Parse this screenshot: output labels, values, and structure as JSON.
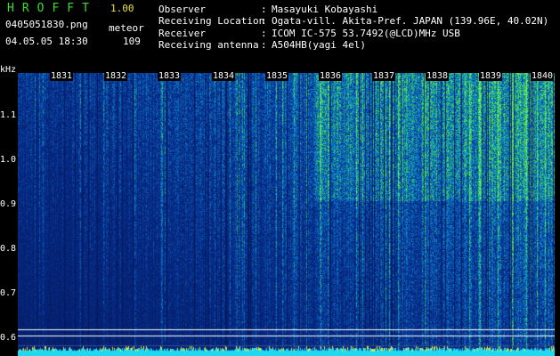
{
  "header": {
    "brand": "HROFFT",
    "version": "1.00",
    "filename": "0405051830.png",
    "mode": "meteor",
    "datetime": "04.05.05 18:30",
    "count": "109"
  },
  "station": [
    {
      "label": "Observer",
      "sep": ":",
      "value": "Masayuki Kobayashi"
    },
    {
      "label": "Receiving Location",
      "sep": ":",
      "value": "Ogata-vill. Akita-Pref. JAPAN (139.96E, 40.02N)"
    },
    {
      "label": "Receiver",
      "sep": ":",
      "value": "ICOM IC-575 53.7492(@LCD)MHz USB"
    },
    {
      "label": "Receiving antenna",
      "sep": ":",
      "value": "A504HB(yagi 4el)"
    }
  ],
  "axis": {
    "unit": "kHz",
    "y_ticks": [
      "1.1",
      "1.0",
      "0.9",
      "0.8",
      "0.7",
      "0.6"
    ],
    "x_ticks": [
      "1831",
      "1832",
      "1833",
      "1834",
      "1835",
      "1836",
      "1837",
      "1838",
      "1839",
      "1840"
    ]
  },
  "colors": {
    "brand": "#38e02a",
    "version": "#e8e33a",
    "background": "#000000",
    "noise_low": "#0a1a6e",
    "noise_high": "#2ef06a",
    "bottom_band": "#20d8f0"
  }
}
